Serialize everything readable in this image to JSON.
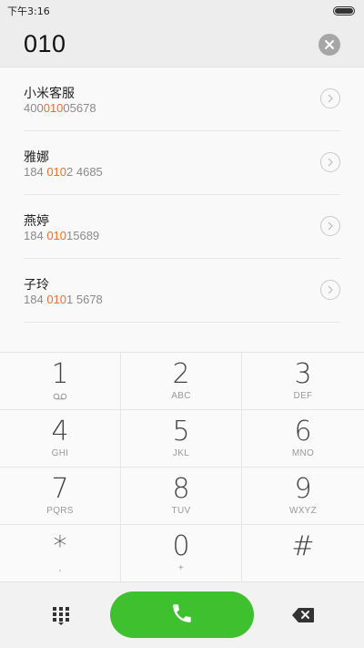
{
  "status_bar": {
    "time": "下午3:16"
  },
  "query": {
    "digits": "010"
  },
  "results": [
    {
      "name": "小米客服",
      "number_pre": "400",
      "number_hl": "010",
      "number_post": "05678"
    },
    {
      "name": "雅娜",
      "number_pre": "184 ",
      "number_hl": "010",
      "number_post": "2 4685"
    },
    {
      "name": "燕婷",
      "number_pre": "184 ",
      "number_hl": "010",
      "number_post": "15689"
    },
    {
      "name": "子玲",
      "number_pre": "184 ",
      "number_hl": "010",
      "number_post": "1 5678"
    }
  ],
  "keypad": [
    {
      "digit": "1",
      "letters": ""
    },
    {
      "digit": "2",
      "letters": "ABC"
    },
    {
      "digit": "3",
      "letters": "DEF"
    },
    {
      "digit": "4",
      "letters": "GHI"
    },
    {
      "digit": "5",
      "letters": "JKL"
    },
    {
      "digit": "6",
      "letters": "MNO"
    },
    {
      "digit": "7",
      "letters": "PQRS"
    },
    {
      "digit": "8",
      "letters": "TUV"
    },
    {
      "digit": "9",
      "letters": "WXYZ"
    },
    {
      "digit": "*",
      "letters": ","
    },
    {
      "digit": "0",
      "letters": "+"
    },
    {
      "digit": "#",
      "letters": ""
    }
  ],
  "icons": {
    "battery": "battery-icon",
    "clear": "clear-icon",
    "detail": "chevron-right-icon",
    "voicemail": "voicemail-icon",
    "dialpad": "dialpad-icon",
    "call": "phone-icon",
    "backspace": "backspace-icon"
  },
  "colors": {
    "highlight": "#f06e2c",
    "call": "#3fc02f"
  }
}
